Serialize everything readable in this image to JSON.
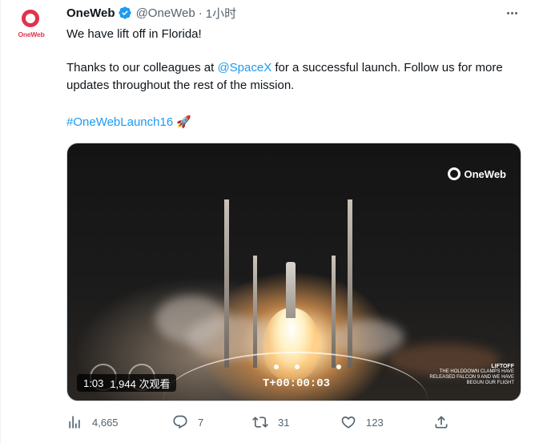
{
  "tweet": {
    "avatar_text": "OneWeb",
    "display_name": "OneWeb",
    "handle": "@OneWeb",
    "separator": "·",
    "time": "1小时",
    "text_line1": "We have lift off in Florida!",
    "text_line2_prefix": "Thanks to our colleagues at ",
    "text_line2_mention": "@SpaceX",
    "text_line2_suffix": " for a successful launch. Follow us for more updates throughout the rest of the mission.",
    "hashtag": "#OneWebLaunch16",
    "emoji": "🚀"
  },
  "media": {
    "overlay_logo": "OneWeb",
    "clock": "T+00:00:03",
    "liftoff_title": "LIFTOFF",
    "liftoff_text": "THE HOLDDOWN CLAMPS HAVE RELEASED FALCON 9 AND WE HAVE BEGUN OUR FLIGHT",
    "duration": "1:03",
    "views": "1,944 次观看"
  },
  "actions": {
    "views": "4,665",
    "replies": "7",
    "retweets": "31",
    "likes": "123"
  },
  "colors": {
    "brand": "#e0334e",
    "link": "#1d9bf0",
    "verified": "#1d9bf0",
    "muted": "#536471"
  }
}
